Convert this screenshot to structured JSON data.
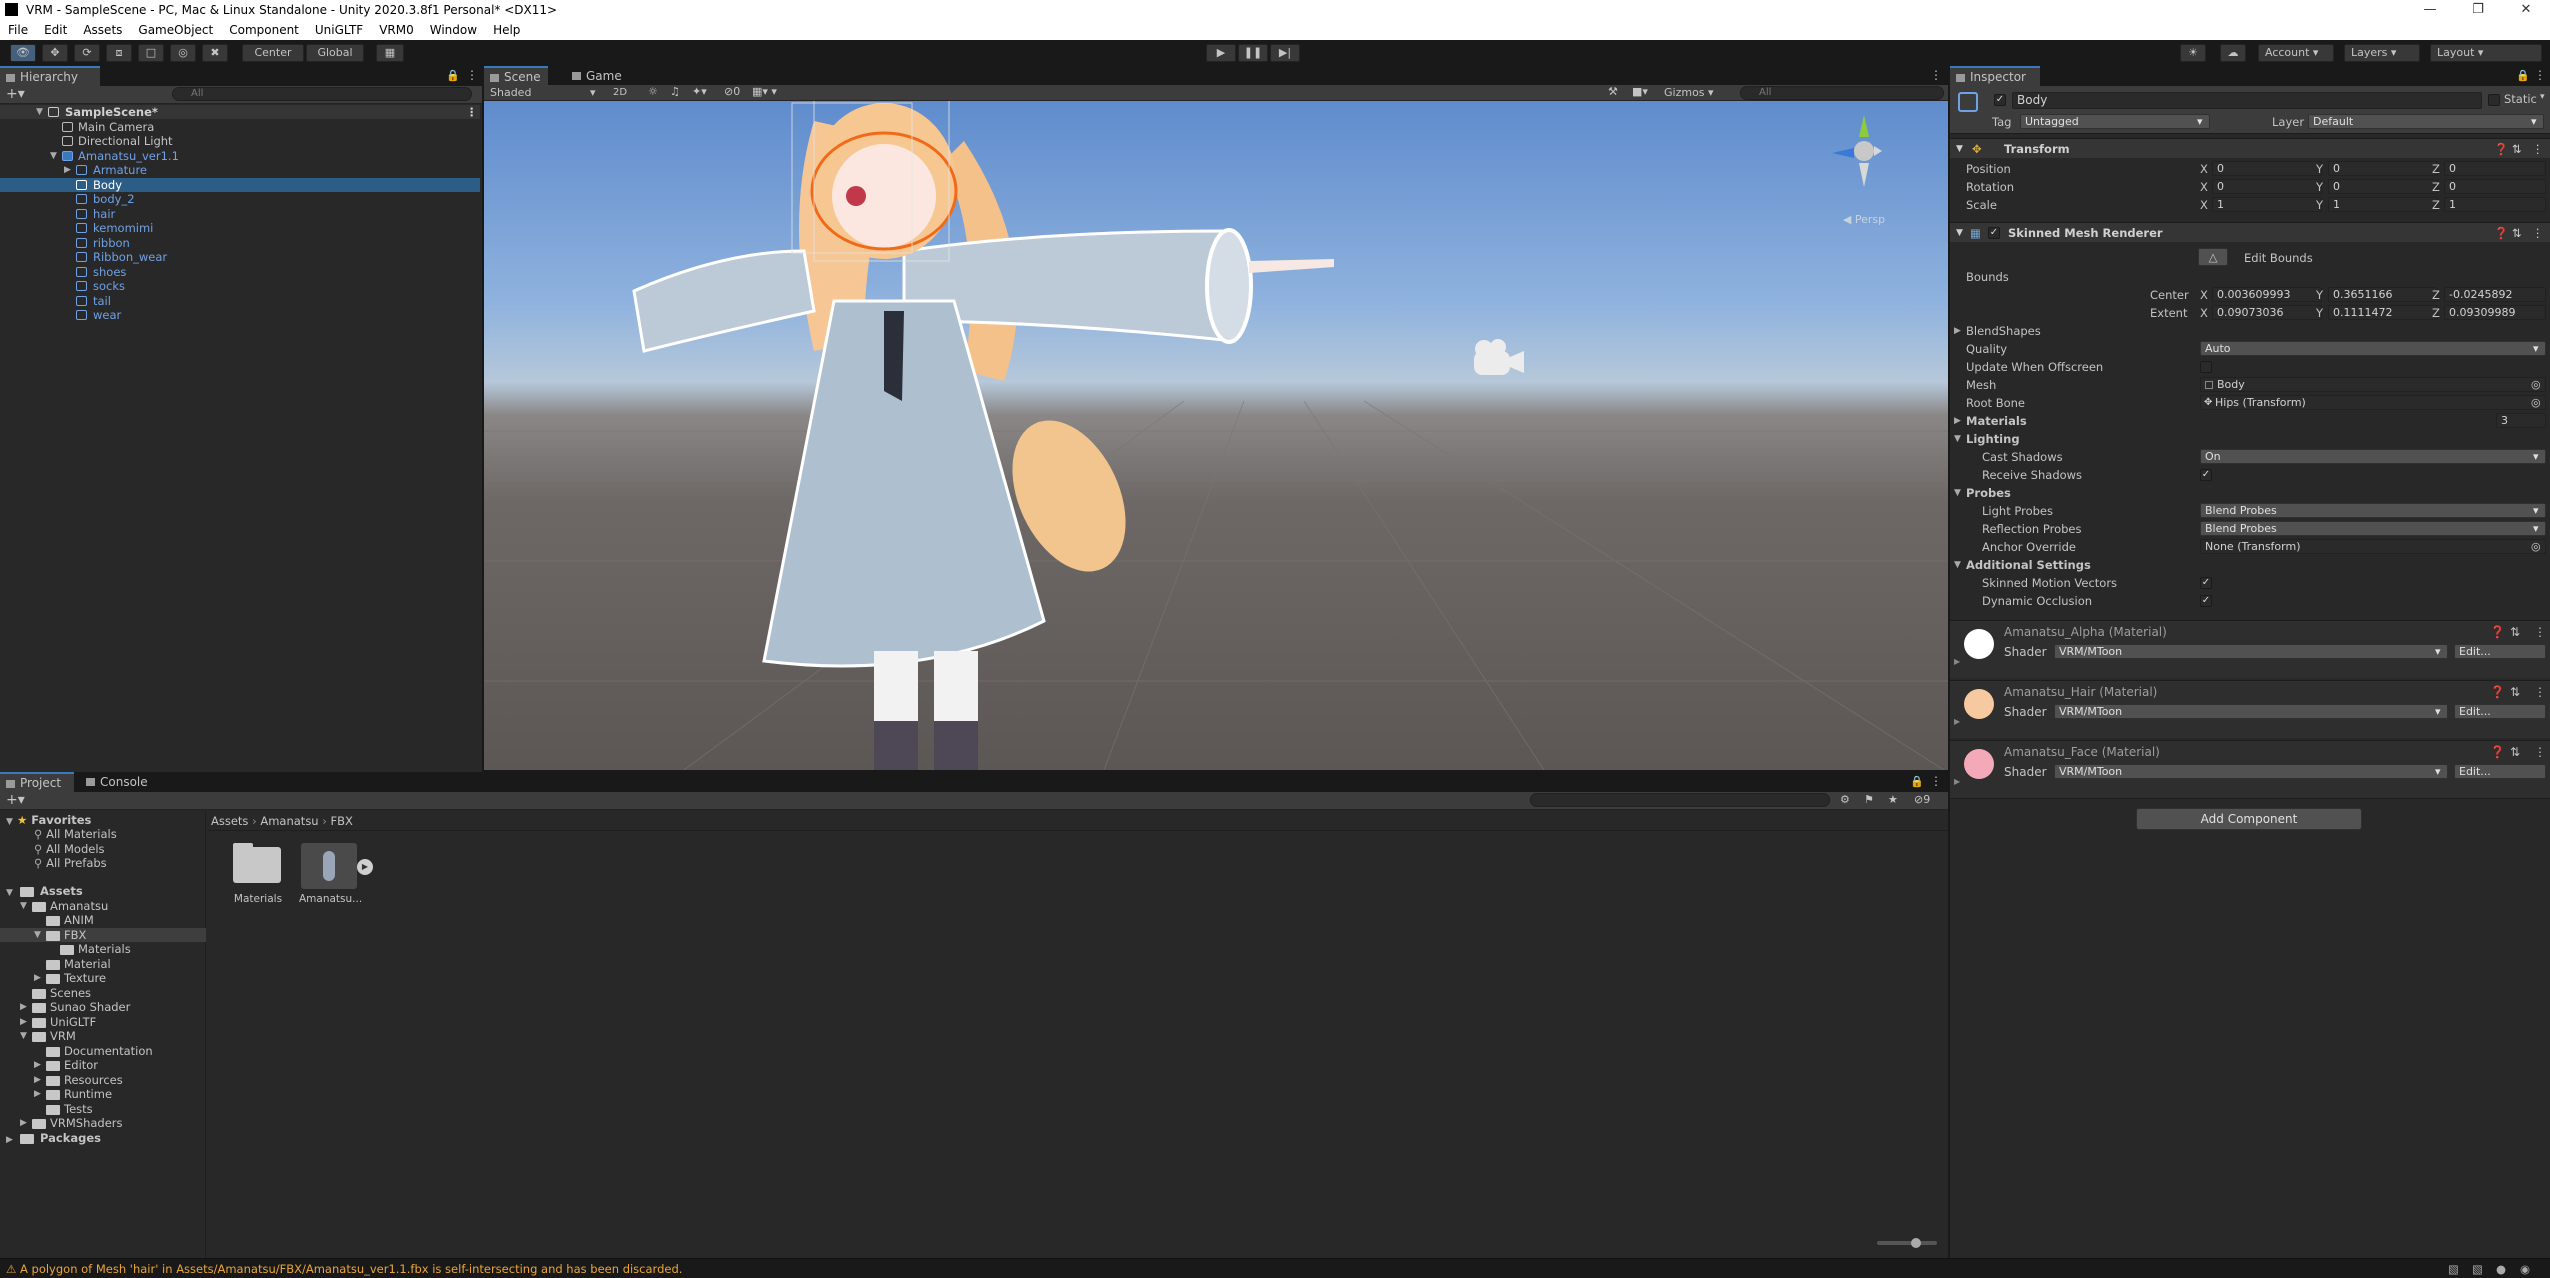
{
  "window": {
    "title": "VRM - SampleScene - PC, Mac & Linux Standalone - Unity 2020.3.8f1 Personal* <DX11>"
  },
  "menu": [
    "File",
    "Edit",
    "Assets",
    "GameObject",
    "Component",
    "UniGLTF",
    "VRM0",
    "Window",
    "Help"
  ],
  "toolbar": {
    "pivot_label": "Center",
    "space_label": "Global",
    "account_label": "Account",
    "layers_label": "Layers",
    "layout_label": "Layout"
  },
  "hierarchy": {
    "tab_label": "Hierarchy",
    "search_placeholder": "All",
    "items": [
      {
        "label": "SampleScene*"
      },
      {
        "label": "Main Camera"
      },
      {
        "label": "Directional Light"
      },
      {
        "label": "Amanatsu_ver1.1"
      },
      {
        "label": "Armature"
      },
      {
        "label": "Body"
      },
      {
        "label": "body_2"
      },
      {
        "label": "hair"
      },
      {
        "label": "kemomimi"
      },
      {
        "label": "ribbon"
      },
      {
        "label": "Ribbon_wear"
      },
      {
        "label": "shoes"
      },
      {
        "label": "socks"
      },
      {
        "label": "tail"
      },
      {
        "label": "wear"
      }
    ]
  },
  "scene": {
    "tabs": [
      "Scene",
      "Game"
    ],
    "shading_mode": "Shaded",
    "mode_2d": "2D",
    "hidden_count": "0",
    "gizmos_label": "Gizmos",
    "search_placeholder": "All",
    "projection_label": "Persp"
  },
  "project": {
    "tabs": [
      "Project",
      "Console"
    ],
    "favorites_label": "Favorites",
    "favorites": [
      "All Materials",
      "All Models",
      "All Prefabs"
    ],
    "assets_label": "Assets",
    "tree": [
      {
        "label": "Amanatsu"
      },
      {
        "label": "ANIM"
      },
      {
        "label": "FBX"
      },
      {
        "label": "Materials"
      },
      {
        "label": "Material"
      },
      {
        "label": "Texture"
      },
      {
        "label": "Scenes"
      },
      {
        "label": "Sunao Shader"
      },
      {
        "label": "UniGLTF"
      },
      {
        "label": "VRM"
      },
      {
        "label": "Documentation"
      },
      {
        "label": "Editor"
      },
      {
        "label": "Resources"
      },
      {
        "label": "Runtime"
      },
      {
        "label": "Tests"
      },
      {
        "label": "VRMShaders"
      }
    ],
    "packages_label": "Packages",
    "breadcrumb": [
      "Assets",
      "Amanatsu",
      "FBX"
    ],
    "items": [
      {
        "label": "Materials"
      },
      {
        "label": "Amanatsu..."
      }
    ],
    "hidden_count": "9"
  },
  "inspector": {
    "tab_label": "Inspector",
    "object_name": "Body",
    "static_label": "Static",
    "tag_label": "Tag",
    "tag_value": "Untagged",
    "layer_label": "Layer",
    "layer_value": "Default",
    "transform": {
      "title": "Transform",
      "position_label": "Position",
      "rotation_label": "Rotation",
      "scale_label": "Scale",
      "position": [
        "0",
        "0",
        "0"
      ],
      "rotation": [
        "0",
        "0",
        "0"
      ],
      "scale": [
        "1",
        "1",
        "1"
      ]
    },
    "axes": [
      "X",
      "Y",
      "Z"
    ],
    "renderer": {
      "title": "Skinned Mesh Renderer",
      "edit_bounds_label": "Edit Bounds",
      "bounds_label": "Bounds",
      "center_label": "Center",
      "extent_label": "Extent",
      "center": [
        "0.003609993",
        "0.3651166",
        "-0.0245892"
      ],
      "extent": [
        "0.09073036",
        "0.1111472",
        "0.09309989"
      ],
      "blendshapes_label": "BlendShapes",
      "quality_label": "Quality",
      "quality_value": "Auto",
      "update_offscreen_label": "Update When Offscreen",
      "mesh_label": "Mesh",
      "mesh_value": "Body",
      "root_bone_label": "Root Bone",
      "root_bone_value": "Hips (Transform)",
      "materials_label": "Materials",
      "materials_count": "3",
      "lighting_label": "Lighting",
      "cast_shadows_label": "Cast Shadows",
      "cast_shadows_value": "On",
      "receive_shadows_label": "Receive Shadows",
      "probes_label": "Probes",
      "light_probes_label": "Light Probes",
      "light_probes_value": "Blend Probes",
      "reflection_probes_label": "Reflection Probes",
      "reflection_probes_value": "Blend Probes",
      "anchor_override_label": "Anchor Override",
      "anchor_override_value": "None (Transform)",
      "additional_label": "Additional Settings",
      "motion_vectors_label": "Skinned Motion Vectors",
      "dynamic_occlusion_label": "Dynamic Occlusion"
    },
    "materials": [
      {
        "name": "Amanatsu_Alpha (Material)",
        "shader": "VRM/MToon",
        "swatch": "#ffffff"
      },
      {
        "name": "Amanatsu_Hair (Material)",
        "shader": "VRM/MToon",
        "swatch": "#f6c9a0"
      },
      {
        "name": "Amanatsu_Face (Material)",
        "shader": "VRM/MToon",
        "swatch": "#f3a9b8"
      }
    ],
    "shader_label": "Shader",
    "edit_label": "Edit...",
    "add_component_label": "Add Component"
  },
  "status": {
    "message": "A polygon of Mesh 'hair' in Assets/Amanatsu/FBX/Amanatsu_ver1.1.fbx is self-intersecting and has been discarded."
  },
  "colors": {
    "selection": "#2c5d87",
    "accent": "#3a79bb",
    "warning": "#e8a53a"
  }
}
